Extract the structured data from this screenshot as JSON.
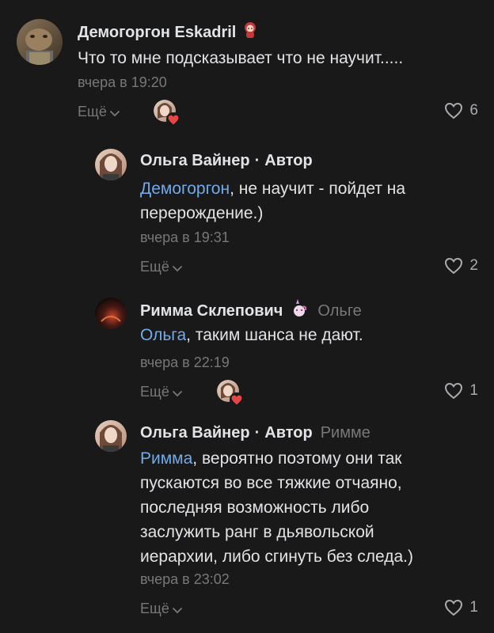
{
  "comments": [
    {
      "author": "Демогоргон Eskadril",
      "author_badge": "red-haired-anime-sticker",
      "text": "Что то мне подсказывает что не научит.....",
      "time": "вчера в 19:20",
      "more_label": "Ещё",
      "likes": "6",
      "liked_by_author": true
    },
    {
      "author": "Ольга Вайнер",
      "author_role": "Автор",
      "separator": "·",
      "mention": "Демогоргон",
      "text_line1": ", не научит - пойдет на",
      "text_line2": "перерождение.)",
      "time": "вчера в 19:31",
      "more_label": "Ещё",
      "likes": "2"
    },
    {
      "author": "Римма Склепович",
      "author_badge": "pink-unicorn-sticker",
      "reply_to": "Ольге",
      "mention": "Ольга",
      "text": ", таким шанса не дают.",
      "time": "вчера в 22:19",
      "more_label": "Ещё",
      "likes": "1",
      "liked_by_author": true
    },
    {
      "author": "Ольга Вайнер",
      "author_role": "Автор",
      "separator": "·",
      "reply_to": "Римме",
      "mention": "Римма",
      "text_line1": ", вероятно поэтому они так",
      "text_line2": "пускаются во все тяжкие отчаяно,",
      "text_line3": "последняя возможность либо",
      "text_line4": "заслужить ранг в дьявольской",
      "text_line5": "иерархии, либо сгинуть без следа.)",
      "time": "вчера в 23:02",
      "more_label": "Ещё",
      "likes": "1"
    }
  ],
  "colors": {
    "background": "#19191a",
    "text": "#e1e3e6",
    "secondary": "#76787a",
    "mention": "#71aaeb",
    "heart_red": "#e64646"
  }
}
